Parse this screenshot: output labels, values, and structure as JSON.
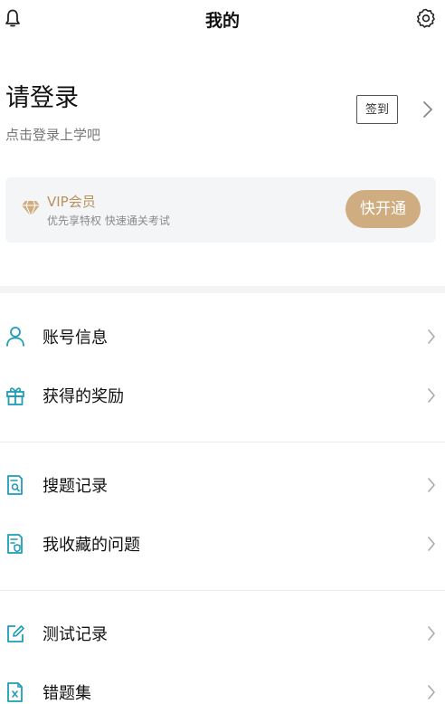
{
  "header": {
    "title": "我的"
  },
  "login": {
    "title": "请登录",
    "subtitle": "点击登录上学吧",
    "signin_label": "签到"
  },
  "vip": {
    "title": "VIP会员",
    "subtitle": "优先享特权 快速通关考试",
    "button_label": "快开通"
  },
  "menu": [
    {
      "label": "账号信息",
      "icon": "person-icon"
    },
    {
      "label": "获得的奖励",
      "icon": "gift-icon"
    },
    {
      "label": "搜题记录",
      "icon": "search-document-icon"
    },
    {
      "label": "我收藏的问题",
      "icon": "favorite-document-icon"
    },
    {
      "label": "测试记录",
      "icon": "edit-icon"
    },
    {
      "label": "错题集",
      "icon": "error-document-icon"
    }
  ],
  "colors": {
    "accent": "#1f9cb8",
    "gold": "#b8925a",
    "vip_button": "#d0ad80"
  }
}
